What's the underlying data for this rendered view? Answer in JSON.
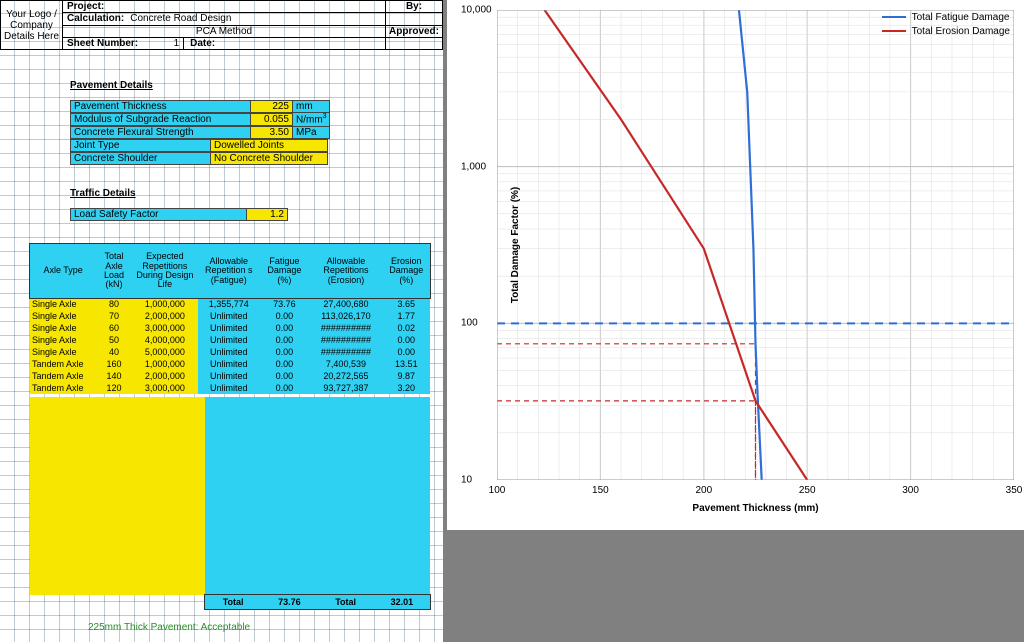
{
  "titleblock": {
    "logo_text": "Your Logo / Company Details Here",
    "project_label": "Project:",
    "calc_label": "Calculation:",
    "calc_value": "Concrete Road Design",
    "method": "PCA Method",
    "sheet_label": "Sheet Number:",
    "sheet_value": "1",
    "date_label": "Date:",
    "by_label": "By:",
    "approved_label": "Approved:"
  },
  "sections": {
    "pavement": "Pavement Details",
    "traffic": "Traffic Details"
  },
  "pavement": {
    "thickness": {
      "label": "Pavement Thickness",
      "value": "225",
      "unit": "mm"
    },
    "modulus": {
      "label": "Modulus of Subgrade Reaction",
      "value": "0.055",
      "unit": "N/mm"
    },
    "flexural": {
      "label": "Concrete Flexural Strength",
      "value": "3.50",
      "unit": "MPa"
    },
    "joint": {
      "label": "Joint Type",
      "value": "Dowelled Joints"
    },
    "shoulder": {
      "label": "Concrete Shoulder",
      "value": "No Concrete Shoulder"
    }
  },
  "traffic": {
    "lsf": {
      "label": "Load Safety Factor",
      "value": "1.2"
    }
  },
  "table": {
    "headers": {
      "axle": "Axle Type",
      "load": "Total Axle Load (kN)",
      "reps": "Expected Repetitions During Design Life",
      "allowF": "Allowable Repetition s (Fatigue)",
      "damF": "Fatigue Damage (%)",
      "allowE": "Allowable Repetitions (Erosion)",
      "damE": "Erosion Damage (%)"
    },
    "rows": [
      {
        "axle": "Single Axle",
        "load": "80",
        "reps": "1,000,000",
        "allowF": "1,355,774",
        "damF": "73.76",
        "allowE": "27,400,680",
        "damE": "3.65"
      },
      {
        "axle": "Single Axle",
        "load": "70",
        "reps": "2,000,000",
        "allowF": "Unlimited",
        "damF": "0.00",
        "allowE": "113,026,170",
        "damE": "1.77"
      },
      {
        "axle": "Single Axle",
        "load": "60",
        "reps": "3,000,000",
        "allowF": "Unlimited",
        "damF": "0.00",
        "allowE": "##########",
        "damE": "0.02"
      },
      {
        "axle": "Single Axle",
        "load": "50",
        "reps": "4,000,000",
        "allowF": "Unlimited",
        "damF": "0.00",
        "allowE": "##########",
        "damE": "0.00"
      },
      {
        "axle": "Single Axle",
        "load": "40",
        "reps": "5,000,000",
        "allowF": "Unlimited",
        "damF": "0.00",
        "allowE": "##########",
        "damE": "0.00"
      },
      {
        "axle": "Tandem Axle",
        "load": "160",
        "reps": "1,000,000",
        "allowF": "Unlimited",
        "damF": "0.00",
        "allowE": "7,400,539",
        "damE": "13.51"
      },
      {
        "axle": "Tandem Axle",
        "load": "140",
        "reps": "2,000,000",
        "allowF": "Unlimited",
        "damF": "0.00",
        "allowE": "20,272,565",
        "damE": "9.87"
      },
      {
        "axle": "Tandem Axle",
        "load": "120",
        "reps": "3,000,000",
        "allowF": "Unlimited",
        "damF": "0.00",
        "allowE": "93,727,387",
        "damE": "3.20"
      }
    ],
    "totals": {
      "label": "Total",
      "fatigue": "73.76",
      "erosion": "32.01"
    }
  },
  "result": {
    "msg": "225mm Thick Pavement: Acceptable"
  },
  "chart_data": {
    "type": "line",
    "xlabel": "Pavement Thickness  (mm)",
    "ylabel": "Total Damage Factor (%)",
    "xlim": [
      100,
      350
    ],
    "ylim": [
      10,
      10000
    ],
    "yscale": "log",
    "x_ticks": [
      100,
      150,
      200,
      250,
      300,
      350
    ],
    "y_ticks": [
      10,
      100,
      1000,
      10000
    ],
    "y_tick_labels": [
      "10",
      "100",
      "1,000",
      "10,000"
    ],
    "series": [
      {
        "name": "Total Fatigue Damage",
        "color": "#2e6fd6",
        "points": [
          {
            "x": 217,
            "y": 10000
          },
          {
            "x": 221,
            "y": 3000
          },
          {
            "x": 224,
            "y": 300
          },
          {
            "x": 225,
            "y": 74
          },
          {
            "x": 226,
            "y": 35
          },
          {
            "x": 228,
            "y": 10
          }
        ]
      },
      {
        "name": "Total Erosion Damage",
        "color": "#c62828",
        "points": [
          {
            "x": 123,
            "y": 10000
          },
          {
            "x": 160,
            "y": 2000
          },
          {
            "x": 200,
            "y": 300
          },
          {
            "x": 225,
            "y": 32
          },
          {
            "x": 250,
            "y": 10
          }
        ]
      }
    ],
    "guides": {
      "horizontal_100": 100,
      "red_horizontal": 74,
      "red_vertical": 225,
      "red_horizontal2": 32,
      "red_vertical2": 225
    }
  }
}
